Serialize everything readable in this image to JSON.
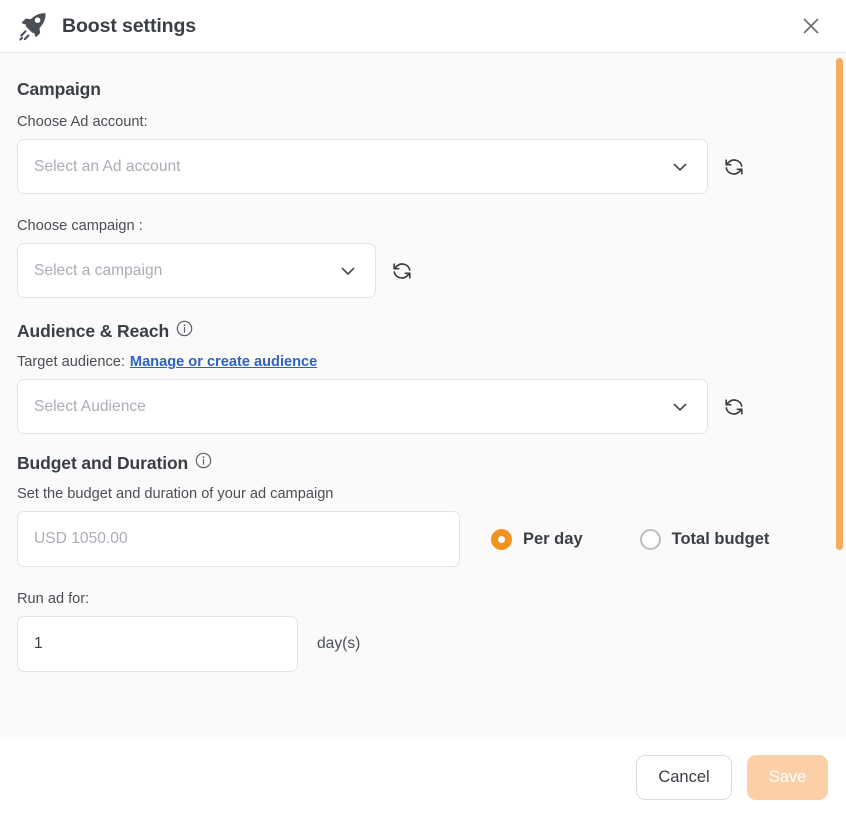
{
  "header": {
    "title": "Boost settings",
    "logo_icon": "rocket-icon",
    "close_icon": "close-icon"
  },
  "campaign": {
    "section_title": "Campaign",
    "ad_account_label": "Choose Ad account:",
    "ad_account_placeholder": "Select an Ad account",
    "ad_account_refresh_icon": "refresh-icon",
    "campaign_label": "Choose campaign :",
    "campaign_placeholder": "Select a campaign",
    "campaign_refresh_icon": "refresh-icon",
    "chevron_icon": "chevron-down-icon"
  },
  "audience": {
    "section_title": "Audience & Reach",
    "info_icon": "info-icon",
    "target_label": "Target audience:",
    "manage_link": "Manage or create audience",
    "audience_placeholder": "Select Audience",
    "audience_refresh_icon": "refresh-icon"
  },
  "budget": {
    "section_title": "Budget and Duration",
    "info_icon": "info-icon",
    "description": "Set the budget and duration of your ad campaign",
    "amount_placeholder": "USD 1050.00",
    "amount_value": "",
    "options": [
      {
        "label": "Per day",
        "selected": true
      },
      {
        "label": "Total budget",
        "selected": false
      }
    ],
    "run_ad_label": "Run ad for:",
    "duration_value": "1",
    "duration_unit": "day(s)"
  },
  "footer": {
    "cancel_label": "Cancel",
    "save_label": "Save"
  },
  "colors": {
    "accent_orange": "#f2921f",
    "save_disabled": "#fbcfa8",
    "scrollbar_thumb": "#f5ab5e",
    "link_blue": "#2f62c4",
    "body_bg": "#fafafa"
  },
  "scrollbar": {
    "name": "vertical-scrollbar"
  }
}
